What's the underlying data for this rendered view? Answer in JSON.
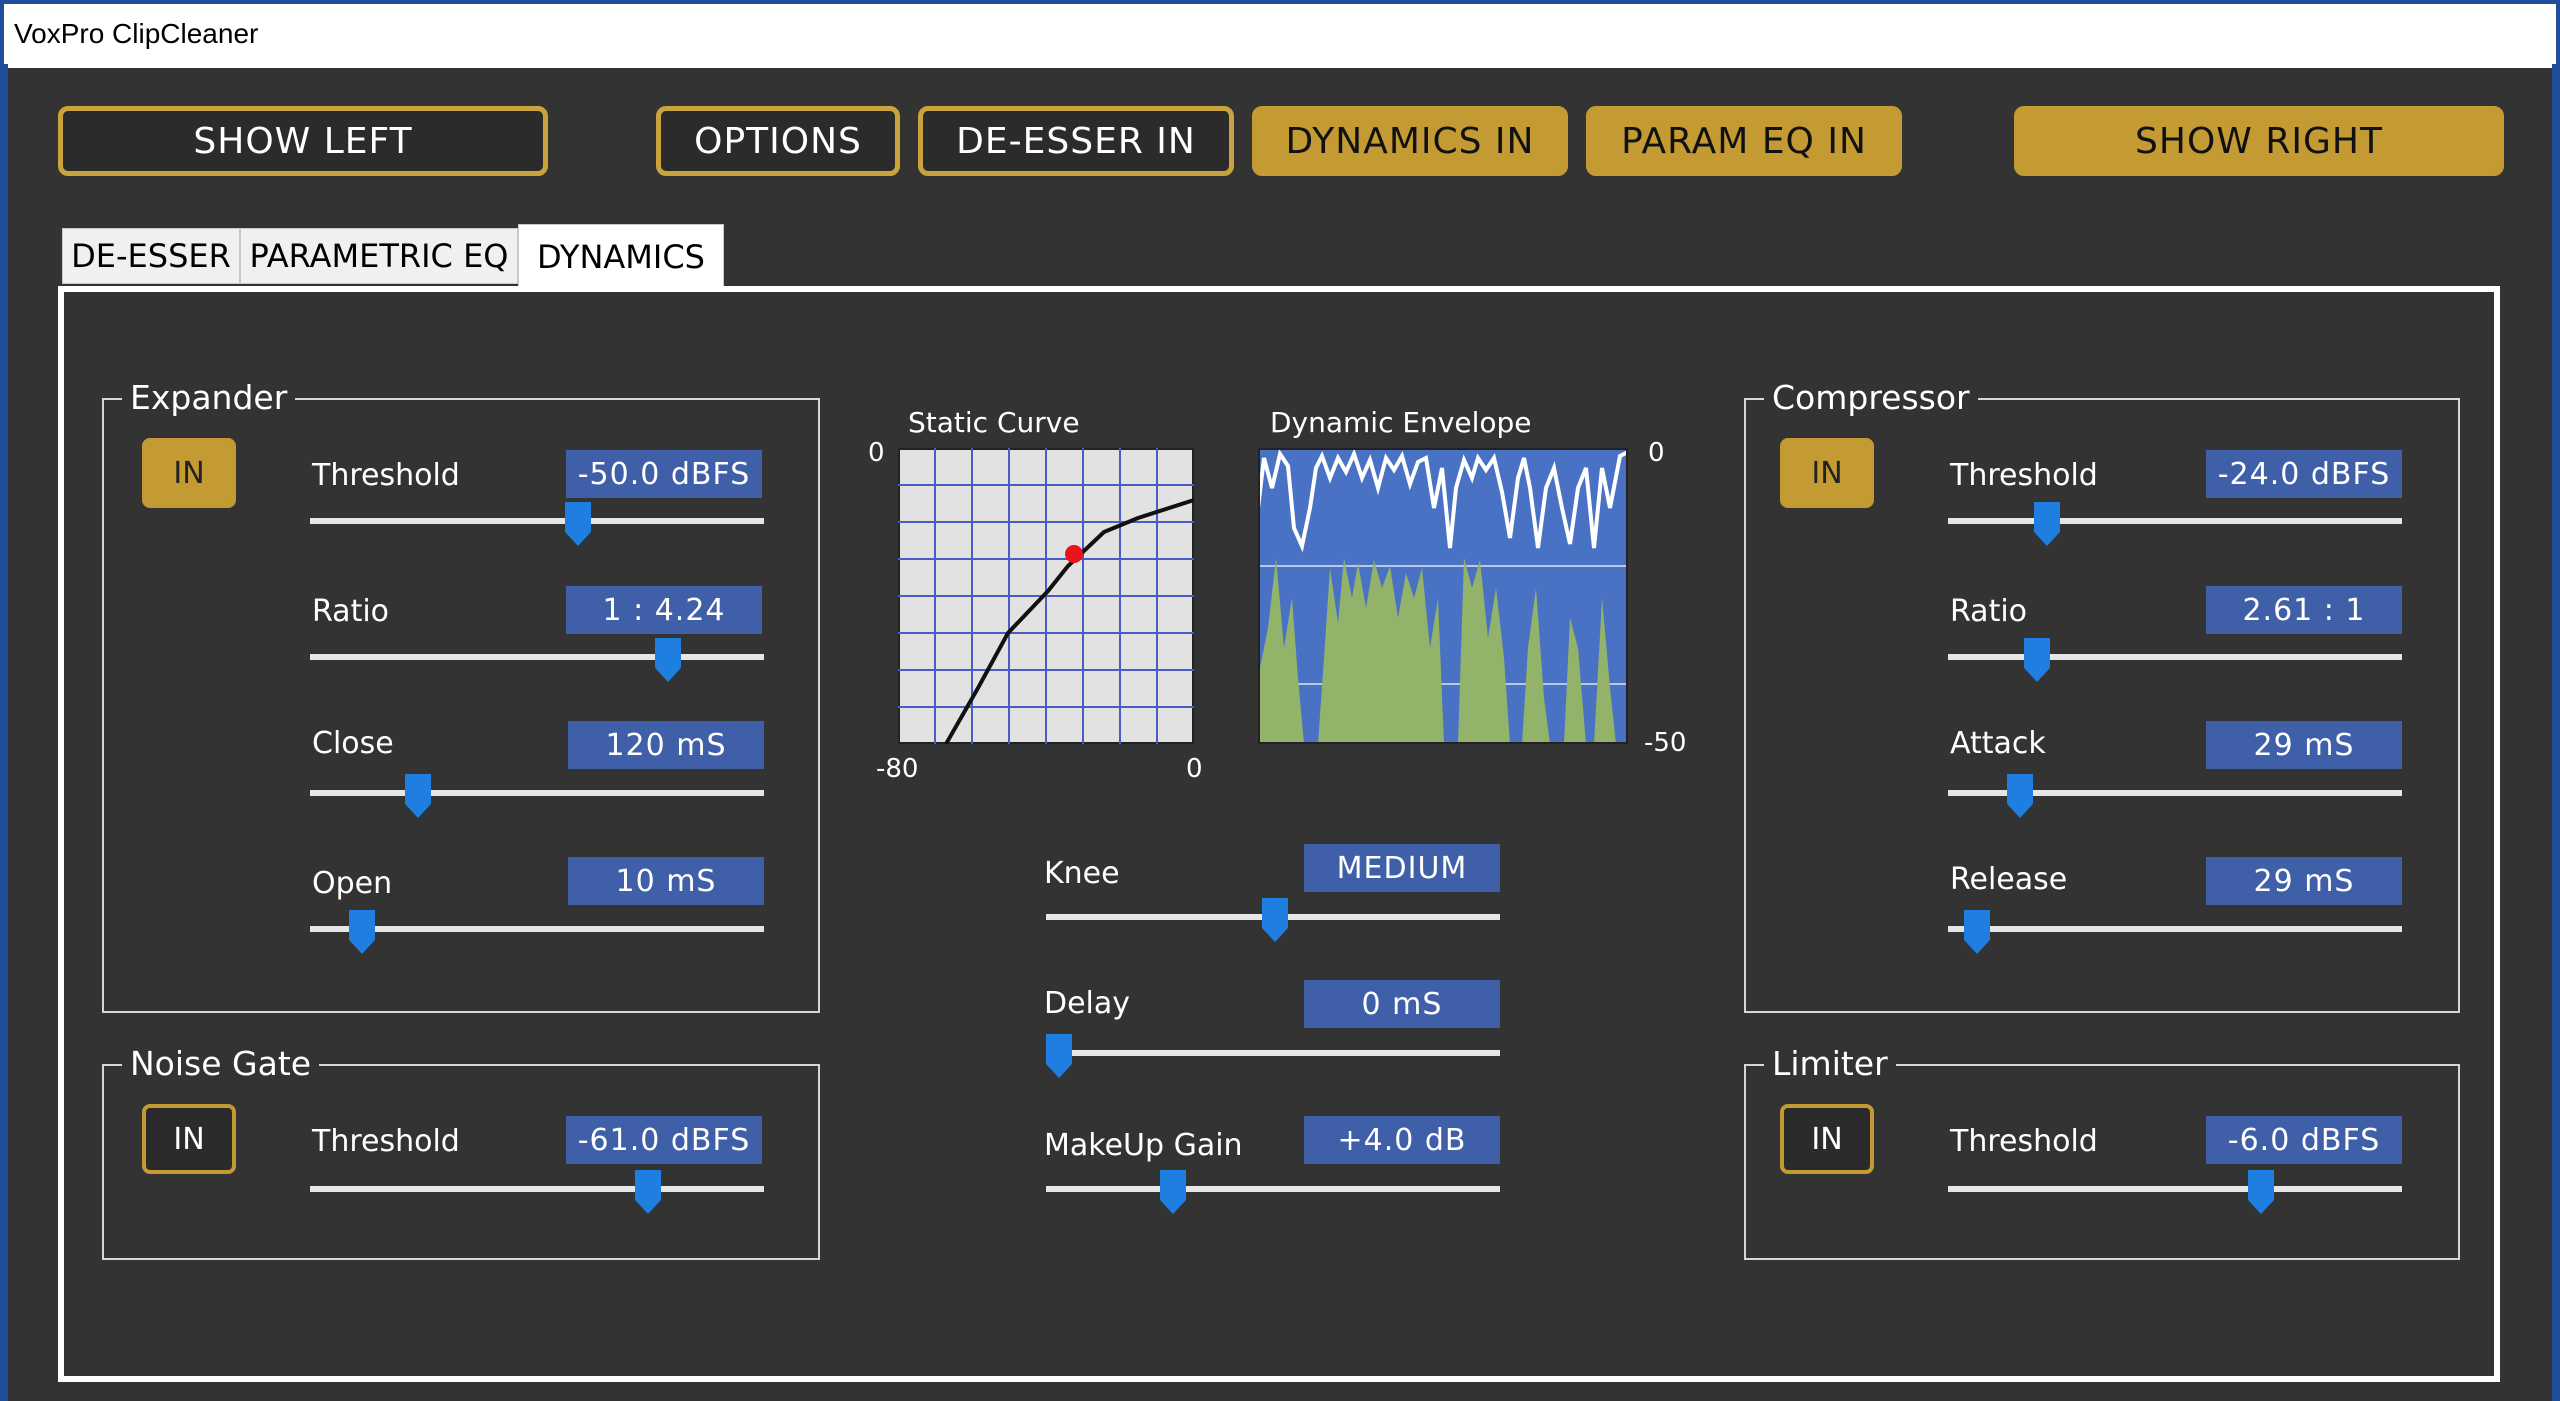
{
  "window": {
    "title": "VoxPro ClipCleaner"
  },
  "toolbar": {
    "show_left": "SHOW LEFT",
    "options": "OPTIONS",
    "deesser_in": "DE-ESSER IN",
    "dynamics_in": "DYNAMICS IN",
    "param_eq_in": "PARAM EQ IN",
    "show_right": "SHOW RIGHT"
  },
  "tabs": [
    {
      "label": "DE-ESSER",
      "active": false
    },
    {
      "label": "PARAMETRIC EQ",
      "active": false
    },
    {
      "label": "DYNAMICS",
      "active": true
    }
  ],
  "expander": {
    "title": "Expander",
    "in_label": "IN",
    "in_active": true,
    "params": [
      {
        "label": "Threshold",
        "value": "-50.0 dBFS",
        "position": 0.59
      },
      {
        "label": "Ratio",
        "value": "1 : 4.24",
        "position": 0.79
      },
      {
        "label": "Close",
        "value": "120 mS",
        "position": 0.24
      },
      {
        "label": "Open",
        "value": "10 mS",
        "position": 0.12
      }
    ]
  },
  "noise_gate": {
    "title": "Noise Gate",
    "in_label": "IN",
    "in_active": false,
    "params": [
      {
        "label": "Threshold",
        "value": "-61.0 dBFS",
        "position": 0.75
      }
    ]
  },
  "static_curve": {
    "title": "Static Curve",
    "y_top": "0",
    "x_left": "-80",
    "x_right": "0"
  },
  "dynamic_envelope": {
    "title": "Dynamic Envelope",
    "y_top": "0",
    "y_bottom": "-50"
  },
  "center": {
    "params": [
      {
        "label": "Knee",
        "value": "MEDIUM",
        "position": 0.5
      },
      {
        "label": "Delay",
        "value": "0 mS",
        "position": 0.03
      },
      {
        "label": "MakeUp Gain",
        "value": "+4.0 dB",
        "position": 0.28
      }
    ]
  },
  "compressor": {
    "title": "Compressor",
    "in_label": "IN",
    "in_active": true,
    "params": [
      {
        "label": "Threshold",
        "value": "-24.0 dBFS",
        "position": 0.22
      },
      {
        "label": "Ratio",
        "value": "2.61 : 1",
        "position": 0.2
      },
      {
        "label": "Attack",
        "value": "29 mS",
        "position": 0.16
      },
      {
        "label": "Release",
        "value": "29 mS",
        "position": 0.06
      }
    ]
  },
  "limiter": {
    "title": "Limiter",
    "in_label": "IN",
    "in_active": false,
    "params": [
      {
        "label": "Threshold",
        "value": "-6.0 dBFS",
        "position": 0.69
      }
    ]
  },
  "colors": {
    "accent_gold": "#c49a33",
    "value_box": "#3f5fa8",
    "slider_thumb": "#1f7fe0",
    "background": "#333333",
    "envelope_fill": "#93b26a",
    "envelope_bg": "#4a72c4"
  }
}
